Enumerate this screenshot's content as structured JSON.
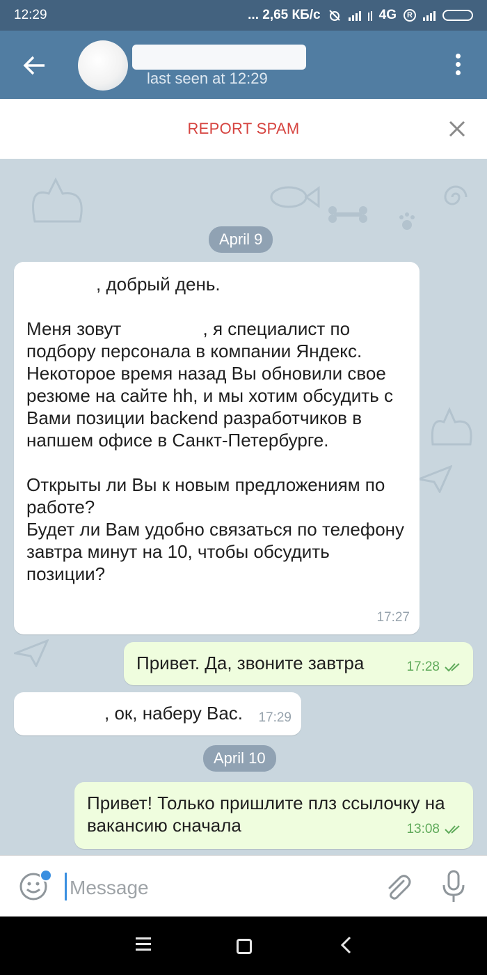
{
  "status_bar": {
    "time": "12:29",
    "network_speed": "... 2,65 КБ/с",
    "network_type": "4G",
    "roaming": "R"
  },
  "header": {
    "status": "last seen at 12:29",
    "icons": [
      "back-arrow-icon",
      "avatar",
      "menu-dots-icon"
    ]
  },
  "report_bar": {
    "label": "REPORT SPAM"
  },
  "chat": {
    "dates": [
      "April 9",
      "April 10"
    ],
    "messages": [
      {
        "direction": "in",
        "greeting_suffix": ", добрый день.",
        "intro_prefix": "Меня зовут ",
        "intro_suffix": ", я специалист по подбору персонала в компании Яндекс. Некоторое время назад Вы обновили свое резюме на сайте hh, и мы хотим обсудить с Вами позиции backend разработчиков в напшем офисе в Санкт-Петербурге.",
        "question": "Открыты ли Вы к новым предложениям по работе?\nБудет ли Вам удобно связаться по телефону завтра минут на 10, чтобы обсудить позиции?",
        "time": "17:27"
      },
      {
        "direction": "out",
        "text": "Привет. Да, звоните завтра",
        "time": "17:28",
        "read": true
      },
      {
        "direction": "in",
        "text": ", ок, наберу Вас.",
        "time": "17:29"
      },
      {
        "direction": "out",
        "text": "Привет! Только пришлите плз ссылочку на вакансию сначала",
        "time": "13:08",
        "read": true
      }
    ]
  },
  "input_bar": {
    "placeholder": "Message"
  },
  "colors": {
    "header": "#517da2",
    "status_bar": "#43627f",
    "report": "#d64541",
    "outgoing_bubble": "#effdde",
    "check_marks": "#5faa5a"
  }
}
